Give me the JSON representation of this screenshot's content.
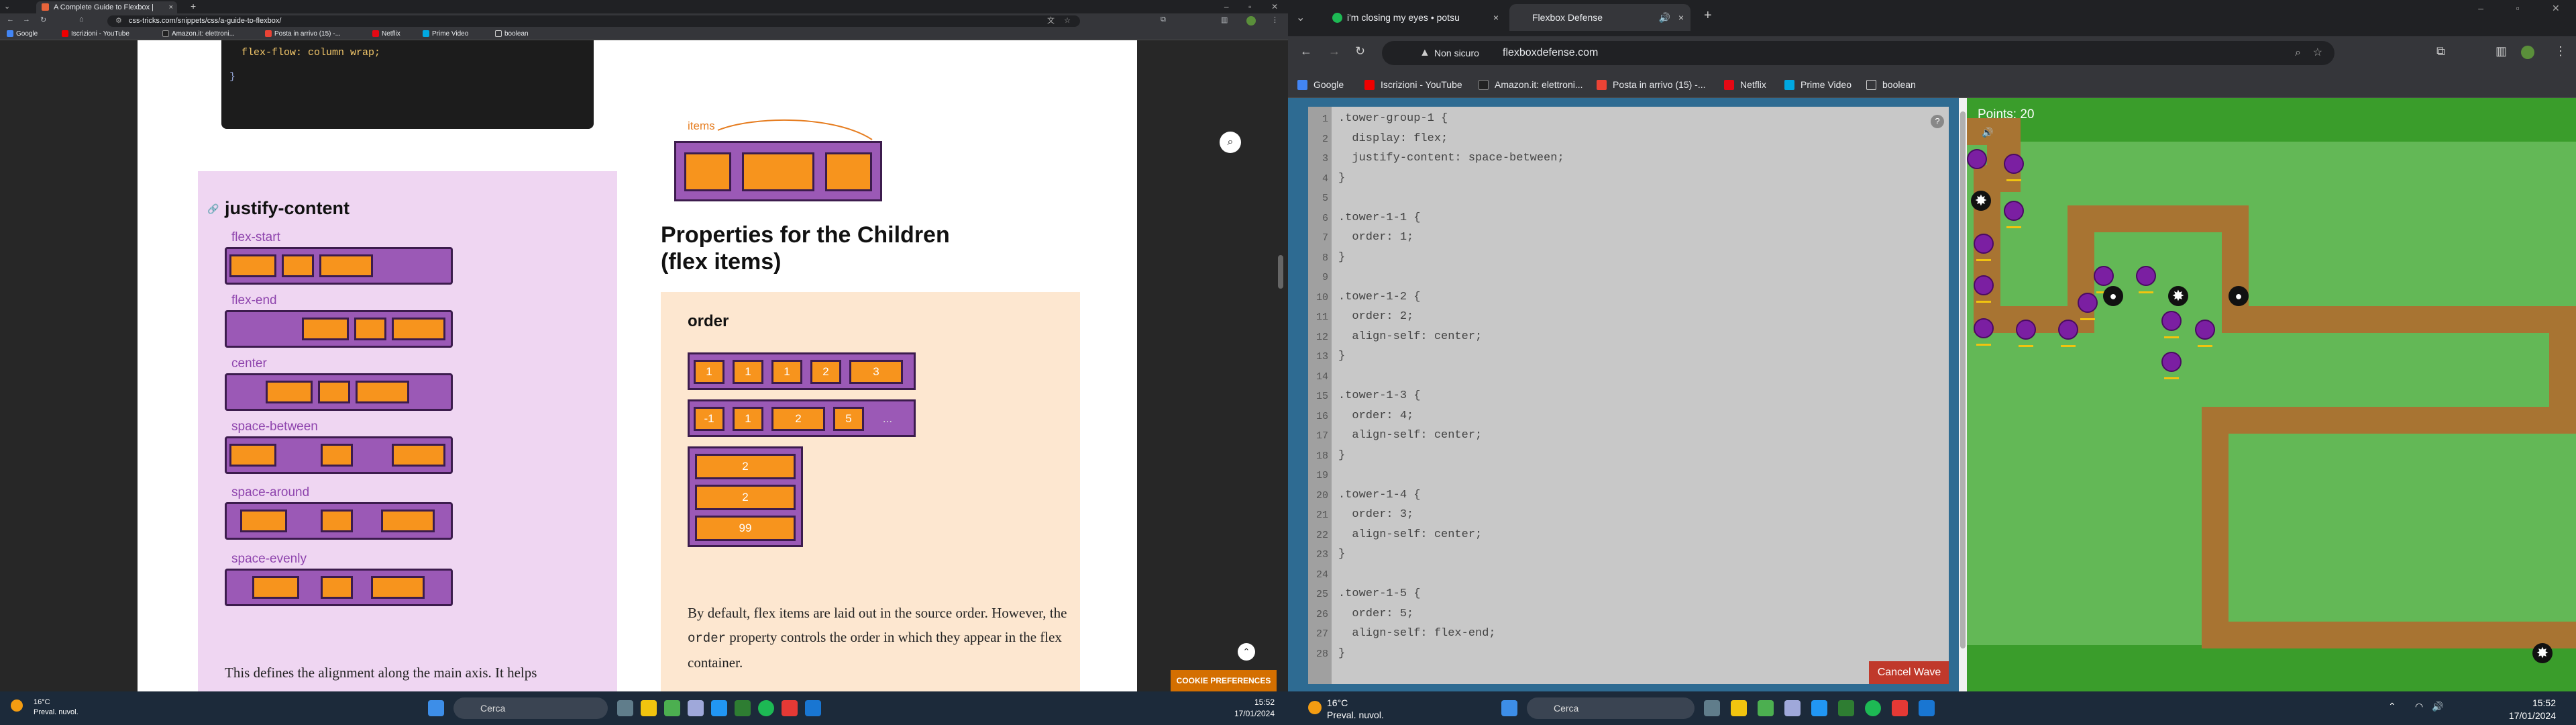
{
  "left": {
    "tab_title": "A Complete Guide to Flexbox |",
    "url": "css-tricks.com/snippets/css/a-guide-to-flexbox/",
    "bookmarks": [
      "Google",
      "Iscrizioni - YouTube",
      "Amazon.it: elettroni...",
      "Posta in arrivo (15) -...",
      "Netflix",
      "Prime Video",
      "boolean"
    ],
    "code_line": "flex-flow: column wrap;",
    "code_close": "}",
    "section_title": "justify-content",
    "justify_labels": [
      "flex-start",
      "flex-end",
      "center",
      "space-between",
      "space-around",
      "space-evenly"
    ],
    "justify_desc": "This defines the alignment along the main axis. It helps",
    "items_label": "items",
    "children_title": "Properties for the Children (flex items)",
    "order_title": "order",
    "order_row1": [
      "1",
      "1",
      "1",
      "2",
      "3"
    ],
    "order_row2": [
      "-1",
      "1",
      "2",
      "5",
      "..."
    ],
    "order_col": [
      "2",
      "2",
      "99"
    ],
    "order_desc_1": "By default, flex items are laid out in the source order. However, the",
    "order_desc_code": "order",
    "order_desc_2": "property controls the order in which they appear in the flex container.",
    "cookie_btn": "COOKIE PREFERENCES",
    "taskbar_weather_temp": "16°C",
    "taskbar_weather_desc": "Preval. nuvol.",
    "taskbar_search": "Cerca",
    "clock_time": "15:52",
    "clock_date": "17/01/2024"
  },
  "right": {
    "tab1_title": "i'm closing my eyes • potsu",
    "tab2_title": "Flexbox Defense",
    "security_label": "Non sicuro",
    "url": "flexboxdefense.com",
    "bookmarks": [
      "Google",
      "Iscrizioni - YouTube",
      "Amazon.it: elettroni...",
      "Posta in arrivo (15) -...",
      "Netflix",
      "Prime Video",
      "boolean"
    ],
    "code_lines": [
      ".tower-group-1 {",
      "  display: flex;",
      "  justify-content: space-between;",
      "}",
      "",
      ".tower-1-1 {",
      "  order: 1;",
      "}",
      "",
      ".tower-1-2 {",
      "  order: 2;",
      "  align-self: center;",
      "}",
      "",
      ".tower-1-3 {",
      "  order: 4;",
      "  align-self: center;",
      "}",
      "",
      ".tower-1-4 {",
      "  order: 3;",
      "  align-self: center;",
      "}",
      "",
      ".tower-1-5 {",
      "  order: 5;",
      "  align-self: flex-end;",
      "}"
    ],
    "line_numbers": [
      "1",
      "2",
      "3",
      "4",
      "5",
      "6",
      "7",
      "8",
      "9",
      "10",
      "11",
      "12",
      "13",
      "14",
      "15",
      "16",
      "17",
      "18",
      "19",
      "20",
      "21",
      "22",
      "23",
      "24",
      "25",
      "26",
      "27",
      "28"
    ],
    "help_label": "?",
    "cancel_button": "Cancel Wave",
    "points": "Points: 20",
    "taskbar_weather_temp": "16°C",
    "taskbar_weather_desc": "Preval. nuvol.",
    "taskbar_search": "Cerca",
    "clock_time": "15:52",
    "clock_date": "17/01/2024"
  },
  "colors": {
    "flex_purple": "#9b59b6",
    "flex_orange": "#f7941d",
    "game_green": "#3a9d2b",
    "path_brown": "#a87432",
    "tower_purple": "#7b1fa2",
    "cancel_red": "#c0392b"
  }
}
